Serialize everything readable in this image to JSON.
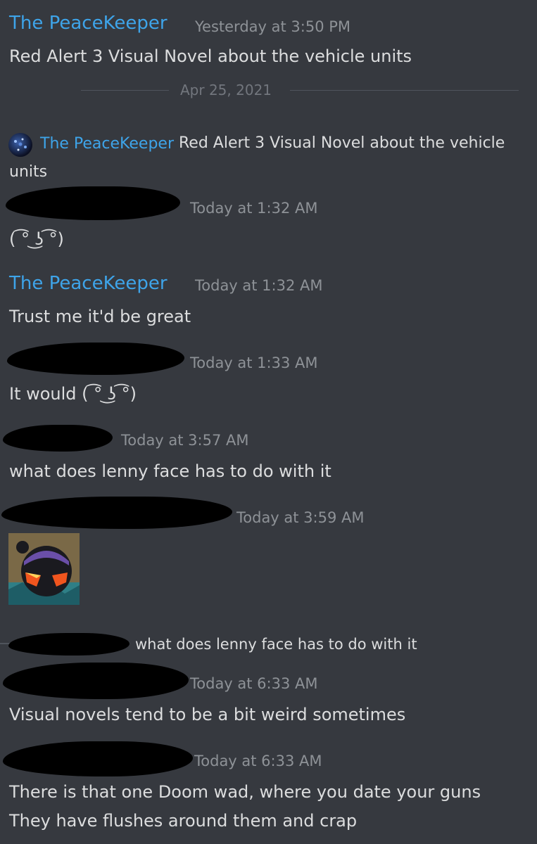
{
  "first_message": {
    "username": "The PeaceKeeper",
    "timestamp": "Yesterday at 3:50 PM",
    "text": "Red Alert 3 Visual Novel about the vehicle units"
  },
  "date_divider": "Apr 25, 2021",
  "reply_preview_1": {
    "username": "The PeaceKeeper",
    "text_line1": "Red Alert 3 Visual Novel about the vehicle",
    "text_line2": "units"
  },
  "message_2": {
    "timestamp": "Today at 1:32 AM",
    "text": "( ͡° ͜ʖ ͡°)"
  },
  "message_3": {
    "username": "The PeaceKeeper",
    "timestamp": "Today at 1:32 AM",
    "text": "Trust me it'd be great"
  },
  "message_4": {
    "timestamp": "Today at 1:33 AM",
    "text": "It would ( ͡° ͜ʖ ͡°)"
  },
  "message_5": {
    "timestamp": "Today at 3:57 AM",
    "text": "what does lenny face has to do with it"
  },
  "message_6": {
    "timestamp": "Today at 3:59 AM"
  },
  "reply_preview_2": {
    "text": "what does lenny face has to do with it"
  },
  "message_7": {
    "timestamp": "Today at 6:33 AM",
    "text": "Visual novels tend to be a bit weird sometimes"
  },
  "message_8": {
    "timestamp": "Today at 6:33 AM",
    "text_line1": "There is that one Doom wad, where you date your guns",
    "text_line2": "They have flushes around them and crap"
  }
}
